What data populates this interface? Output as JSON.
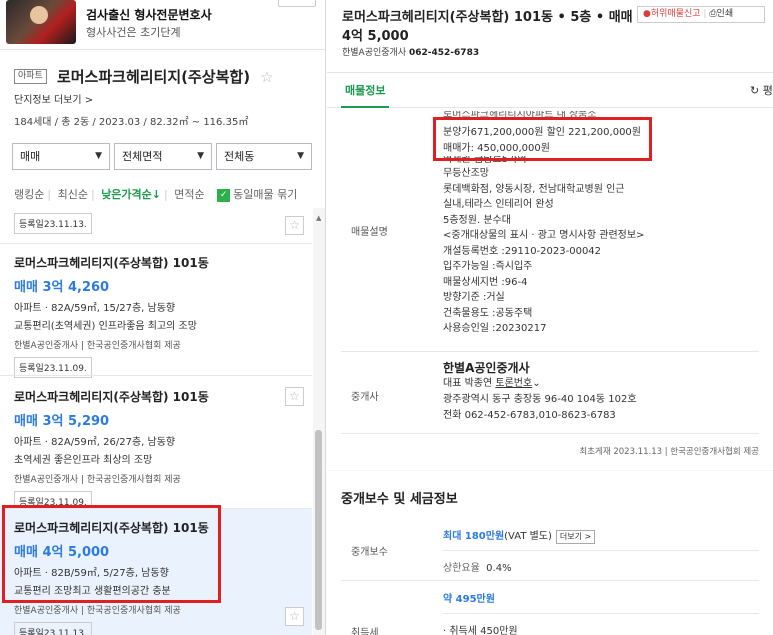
{
  "ad": {
    "title": "검사출신 형사전문변호사",
    "subtitle": "형사사건은 초기단계"
  },
  "complex": {
    "badge": "아파트",
    "name": "로머스파크헤리티지(주상복합)",
    "link": "단지정보 더보기 >",
    "info": "184세대 / 총 2동 / 2023.03 / 82.32㎡ ~ 116.35㎡"
  },
  "filters": [
    "매매",
    "전체면적",
    "전체동"
  ],
  "sorts": {
    "rank": "랭킹순",
    "recent": "최신순",
    "price": "낮은가격순↓",
    "area": "면적순",
    "same": "동일매물 묶기"
  },
  "list": {
    "top_date": "등록일23.11.13.",
    "items": [
      {
        "title": "로머스파크헤리티지(주상복합) 101동",
        "price": "매매 3억 4,260",
        "detail": "아파트 · 82A/59㎡, 15/27층, 남동향",
        "remark": "교통편리(초역세권) 인프라좋음 최고의 조망",
        "broker": "한별A공인중개사 | 한국공인중개사협회 제공",
        "date": "등록일23.11.09."
      },
      {
        "title": "로머스파크헤리티지(주상복합) 101동",
        "price": "매매 3억 5,290",
        "detail": "아파트 · 82A/59㎡, 26/27층, 남동향",
        "remark": "초역세권 좋은인프라 최상의 조망",
        "broker": "한별A공인중개사 | 한국공인중개사협회 제공",
        "date": "등록일23.11.09."
      },
      {
        "title": "로머스파크헤리티지(주상복합) 101동",
        "price": "매매 4억 5,000",
        "detail": "아파트 · 82B/59㎡, 5/27층, 남동향",
        "remark": "교통편리 조망최고 생활편의공간 충분",
        "broker": "한별A공인중개사 | 한국공인중개사협회 제공",
        "date": "등록일23.11.13."
      }
    ]
  },
  "detail": {
    "title_line1": "로머스파크헤리티지(주상복합) 101동 • 5층 • 매매",
    "title_line2": "4억 5,000",
    "broker_label": "한별A공인중개사",
    "phone": "062-452-6783",
    "report": "허위매물신고",
    "print": "인쇄",
    "tab": "매물정보",
    "tab_right": "평",
    "desc_label": "매물설명",
    "desc_lines": [
      "로머스파크헤리티지아파트 내 상품소",
      "분양가671,200,000원 할인 221,200,000원",
      "매매가: 450,000,000원",
      "역세권-금남로5가역",
      "무등산조망",
      "롯데백화점, 양동시장, 전남대학교병원 인근",
      "실내,테라스 인테리어 완성",
      "5층정원. 분수대",
      "<중개대상물의 표시 · 광고 명시사항 관련정보>",
      "개설등록번호 :29110-2023-00042",
      "입주가능일 :즉시입주",
      "매물상세지번 :96-4",
      "방향기준 :거실",
      "건축물용도 :공동주택",
      "사용승인일 :20230217"
    ],
    "agent_label": "중개사",
    "agent_name": "한별A공인중개사",
    "agent_rep": "대표 박종연",
    "agent_more": "토론번호",
    "agent_addr": "광주광역시 동구 충장동 96-40 104동 102호",
    "agent_tel": "전화 062-452-6783,010-8623-6783",
    "footer": "최초게재 2023.11.13 | 한국공인중개사협회 제공"
  },
  "fees": {
    "heading": "중개보수 및 세금정보",
    "fee_label": "중개보수",
    "fee_max": "최대 180만원",
    "fee_vat": "(VAT 별도)",
    "fee_more": "더보기 >",
    "rate_label": "상한요율",
    "rate": "0.4%",
    "tax_amount": "약 495만원",
    "tax_label": "취득세",
    "tax_detail": "· 취득세 450만원"
  }
}
